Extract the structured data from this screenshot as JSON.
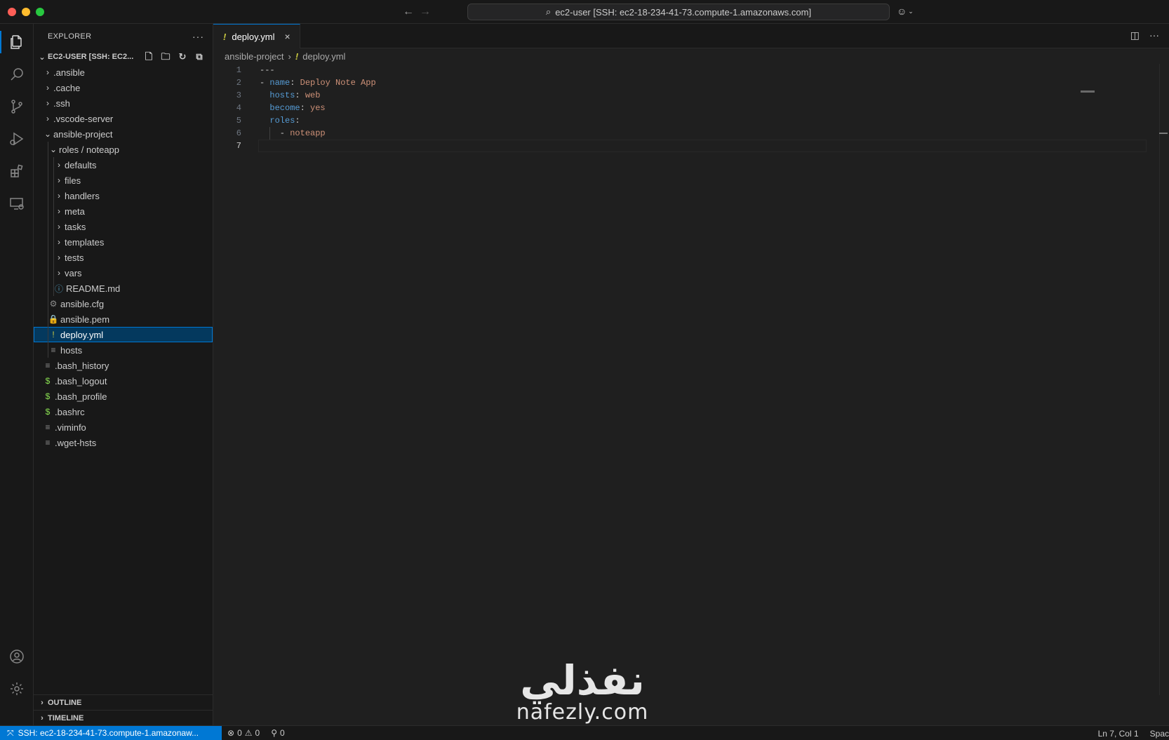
{
  "titlebar": {
    "search_text": "ec2-user [SSH: ec2-18-234-41-73.compute-1.amazonaws.com]",
    "back_icon": "arrow-left-icon",
    "forward_icon": "arrow-right-icon"
  },
  "sidebar": {
    "title": "EXPLORER",
    "root_label": "EC2-USER [SSH: EC2...",
    "tree": [
      {
        "label": ".ansible",
        "type": "folder",
        "depth": 0,
        "expanded": false
      },
      {
        "label": ".cache",
        "type": "folder",
        "depth": 0,
        "expanded": false
      },
      {
        "label": ".ssh",
        "type": "folder",
        "depth": 0,
        "expanded": false
      },
      {
        "label": ".vscode-server",
        "type": "folder",
        "depth": 0,
        "expanded": false
      },
      {
        "label": "ansible-project",
        "type": "folder",
        "depth": 0,
        "expanded": true
      },
      {
        "label": "roles / noteapp",
        "type": "folder",
        "depth": 1,
        "expanded": true
      },
      {
        "label": "defaults",
        "type": "folder",
        "depth": 2,
        "expanded": false
      },
      {
        "label": "files",
        "type": "folder",
        "depth": 2,
        "expanded": false
      },
      {
        "label": "handlers",
        "type": "folder",
        "depth": 2,
        "expanded": false
      },
      {
        "label": "meta",
        "type": "folder",
        "depth": 2,
        "expanded": false
      },
      {
        "label": "tasks",
        "type": "folder",
        "depth": 2,
        "expanded": false
      },
      {
        "label": "templates",
        "type": "folder",
        "depth": 2,
        "expanded": false
      },
      {
        "label": "tests",
        "type": "folder",
        "depth": 2,
        "expanded": false
      },
      {
        "label": "vars",
        "type": "folder",
        "depth": 2,
        "expanded": false
      },
      {
        "label": "README.md",
        "type": "file",
        "depth": 2,
        "icon": "ⓘ",
        "icon_color": "#519aba"
      },
      {
        "label": "ansible.cfg",
        "type": "file",
        "depth": 1,
        "icon": "⚙",
        "icon_color": "#8b8b8b"
      },
      {
        "label": "ansible.pem",
        "type": "file",
        "depth": 1,
        "icon": "🔒",
        "icon_color": "#cbcb41"
      },
      {
        "label": "deploy.yml",
        "type": "file",
        "depth": 1,
        "icon": "!",
        "icon_color": "#cbcb41",
        "selected": true
      },
      {
        "label": "hosts",
        "type": "file",
        "depth": 1,
        "icon": "≡",
        "icon_color": "#8b8b8b"
      },
      {
        "label": ".bash_history",
        "type": "file",
        "depth": 0,
        "icon": "≡",
        "icon_color": "#8b8b8b"
      },
      {
        "label": ".bash_logout",
        "type": "file",
        "depth": 0,
        "icon": "$",
        "icon_color": "#89e051"
      },
      {
        "label": ".bash_profile",
        "type": "file",
        "depth": 0,
        "icon": "$",
        "icon_color": "#89e051"
      },
      {
        "label": ".bashrc",
        "type": "file",
        "depth": 0,
        "icon": "$",
        "icon_color": "#89e051"
      },
      {
        "label": ".viminfo",
        "type": "file",
        "depth": 0,
        "icon": "≡",
        "icon_color": "#8b8b8b"
      },
      {
        "label": ".wget-hsts",
        "type": "file",
        "depth": 0,
        "icon": "≡",
        "icon_color": "#8b8b8b"
      }
    ],
    "outline_label": "OUTLINE",
    "timeline_label": "TIMELINE"
  },
  "editor": {
    "tab_label": "deploy.yml",
    "breadcrumb_folder": "ansible-project",
    "breadcrumb_file": "deploy.yml",
    "lines": [
      {
        "num": "1",
        "parts": [
          {
            "t": "---",
            "c": "p"
          }
        ]
      },
      {
        "num": "2",
        "parts": [
          {
            "t": "- ",
            "c": "dash"
          },
          {
            "t": "name",
            "c": "k"
          },
          {
            "t": ": ",
            "c": "p"
          },
          {
            "t": "Deploy Note App",
            "c": "s"
          }
        ]
      },
      {
        "num": "3",
        "parts": [
          {
            "t": "  ",
            "c": "p"
          },
          {
            "t": "hosts",
            "c": "k"
          },
          {
            "t": ": ",
            "c": "p"
          },
          {
            "t": "web",
            "c": "s"
          }
        ]
      },
      {
        "num": "4",
        "parts": [
          {
            "t": "  ",
            "c": "p"
          },
          {
            "t": "become",
            "c": "k"
          },
          {
            "t": ": ",
            "c": "p"
          },
          {
            "t": "yes",
            "c": "s"
          }
        ]
      },
      {
        "num": "5",
        "parts": [
          {
            "t": "  ",
            "c": "p"
          },
          {
            "t": "roles",
            "c": "k"
          },
          {
            "t": ":",
            "c": "p"
          }
        ]
      },
      {
        "num": "6",
        "parts": [
          {
            "t": "    - ",
            "c": "dash"
          },
          {
            "t": "noteapp",
            "c": "s"
          }
        ]
      },
      {
        "num": "7",
        "parts": [],
        "current": true
      }
    ]
  },
  "statusbar": {
    "remote_label": "SSH: ec2-18-234-41-73.compute-1.amazonaw...",
    "errors": "0",
    "warnings": "0",
    "ports": "0",
    "cursor": "Ln 7, Col 1",
    "spaces": "Spac"
  },
  "watermark": {
    "logo_text": "نفذلي",
    "site": "nafezly.com"
  },
  "colors": {
    "accent": "#0078d4",
    "selection": "#04395e",
    "yaml_key": "#569cd6",
    "yaml_value": "#ce9178"
  }
}
